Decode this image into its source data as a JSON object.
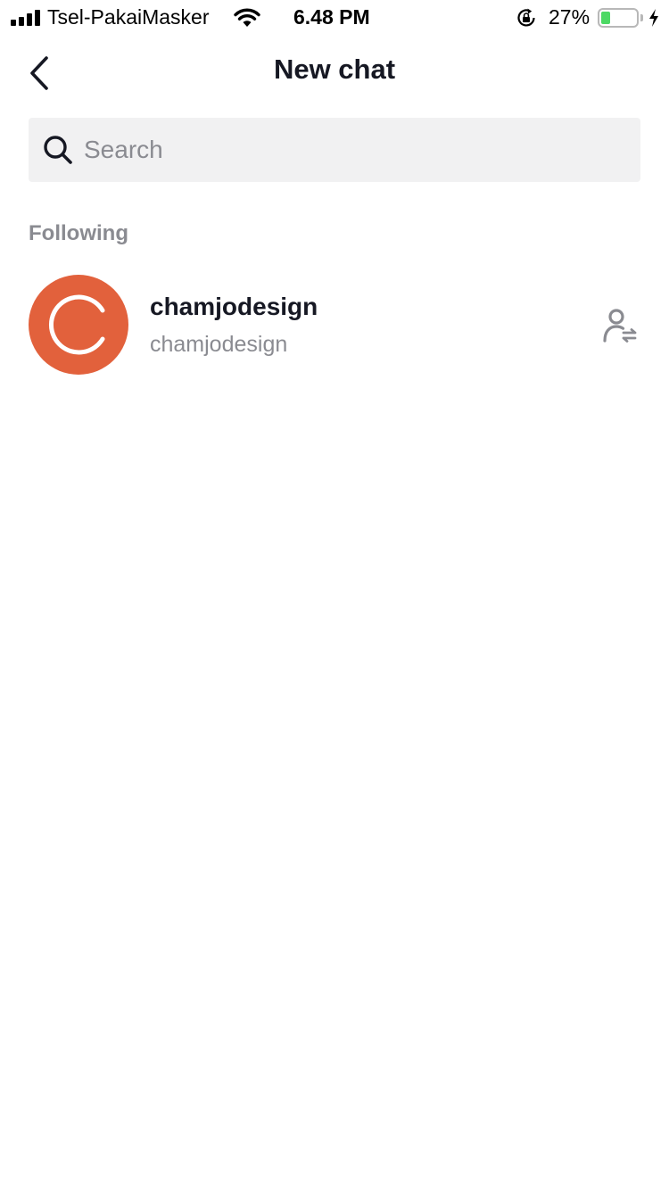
{
  "status_bar": {
    "carrier": "Tsel-PakaiMasker",
    "time": "6.48 PM",
    "battery_percent": "27%",
    "battery_level": 0.27,
    "battery_color": "#4cd964",
    "icons": [
      "signal-icon",
      "wifi-icon",
      "rotation-lock-icon",
      "battery-icon",
      "charging-bolt-icon"
    ]
  },
  "nav": {
    "title": "New chat",
    "back_icon": "chevron-left-icon"
  },
  "search": {
    "placeholder": "Search",
    "value": "",
    "icon": "search-icon"
  },
  "section": {
    "label": "Following"
  },
  "users": [
    {
      "name": "chamjodesign",
      "handle": "chamjodesign",
      "avatar_color": "#e2613c",
      "action_icon": "user-switch-icon"
    }
  ]
}
